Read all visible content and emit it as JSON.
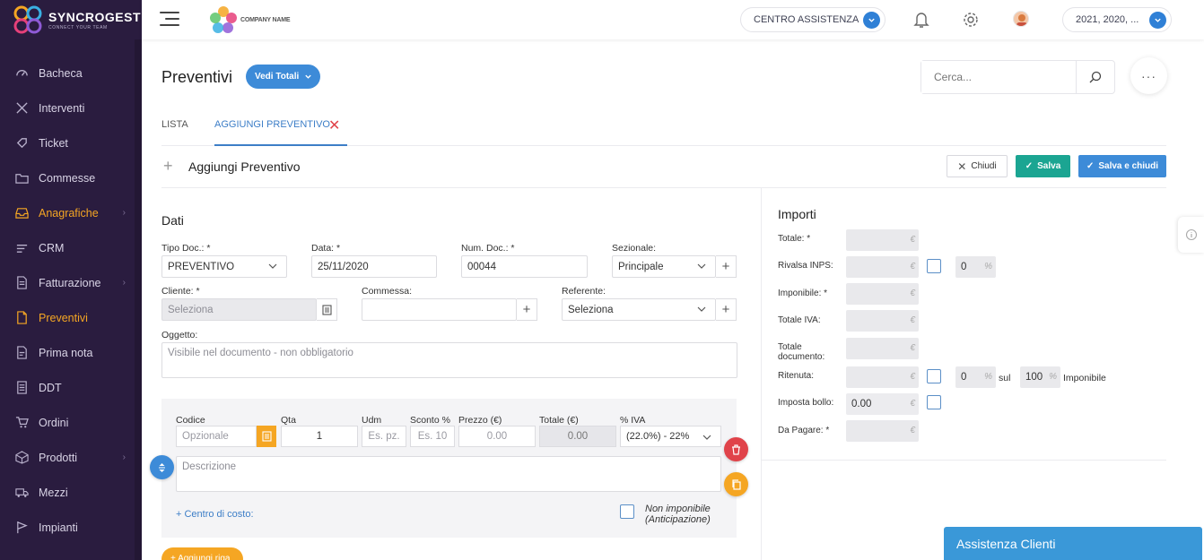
{
  "brand": {
    "name": "SYNCROGEST",
    "tagline": "CONNECT YOUR TEAM"
  },
  "sidebar": {
    "items": [
      {
        "label": "Bacheca",
        "icon": "gauge-icon",
        "active": false,
        "has_children": false
      },
      {
        "label": "Interventi",
        "icon": "tools-icon",
        "active": false,
        "has_children": false
      },
      {
        "label": "Ticket",
        "icon": "ticket-icon",
        "active": false,
        "has_children": false
      },
      {
        "label": "Commesse",
        "icon": "folder-icon",
        "active": false,
        "has_children": false
      },
      {
        "label": "Anagrafiche",
        "icon": "inbox-icon",
        "active": true,
        "has_children": true
      },
      {
        "label": "CRM",
        "icon": "crm-icon",
        "active": false,
        "has_children": false
      },
      {
        "label": "Fatturazione",
        "icon": "invoice-icon",
        "active": false,
        "has_children": true
      },
      {
        "label": "Preventivi",
        "icon": "quote-icon",
        "active": true,
        "has_children": false
      },
      {
        "label": "Prima nota",
        "icon": "note-icon",
        "active": false,
        "has_children": false
      },
      {
        "label": "DDT",
        "icon": "document-icon",
        "active": false,
        "has_children": false
      },
      {
        "label": "Ordini",
        "icon": "cart-icon",
        "active": false,
        "has_children": false
      },
      {
        "label": "Prodotti",
        "icon": "box-icon",
        "active": false,
        "has_children": true
      },
      {
        "label": "Mezzi",
        "icon": "truck-icon",
        "active": false,
        "has_children": false
      },
      {
        "label": "Impianti",
        "icon": "flag-icon",
        "active": false,
        "has_children": false
      }
    ],
    "active_color": "#f5a623"
  },
  "topbar": {
    "company_name": "COMPANY NAME",
    "help_label": "CENTRO ASSISTENZA",
    "years_label": "2021, 2020, ..."
  },
  "page": {
    "title": "Preventivi",
    "totals_button": "Vedi Totali",
    "search_placeholder": "Cerca...",
    "more": "···"
  },
  "tabs": [
    {
      "label": "LISTA",
      "active": false
    },
    {
      "label": "AGGIUNGI PREVENTIVO",
      "active": true
    }
  ],
  "form_header": {
    "title": "Aggiungi Preventivo",
    "close_label": "Chiudi",
    "save_label": "Salva",
    "save_close_label": "Salva e chiudi"
  },
  "dati": {
    "title": "Dati",
    "tipo_doc": {
      "label": "Tipo Doc.: *",
      "value": "PREVENTIVO"
    },
    "data": {
      "label": "Data: *",
      "value": "25/11/2020"
    },
    "num_doc": {
      "label": "Num. Doc.: *",
      "value": "00044"
    },
    "sezionale": {
      "label": "Sezionale:",
      "value": "Principale"
    },
    "cliente": {
      "label": "Cliente: *",
      "placeholder": "Seleziona"
    },
    "commessa": {
      "label": "Commessa:",
      "value": ""
    },
    "referente": {
      "label": "Referente:",
      "placeholder": "Seleziona"
    },
    "oggetto": {
      "label": "Oggetto:",
      "placeholder": "Visibile nel documento - non obbligatorio"
    }
  },
  "row": {
    "codice": {
      "label": "Codice",
      "placeholder": "Opzionale"
    },
    "qta": {
      "label": "Qta",
      "value": "1"
    },
    "udm": {
      "label": "Udm",
      "placeholder": "Es. pz."
    },
    "sconto": {
      "label": "Sconto %",
      "placeholder": "Es. 10"
    },
    "prezzo": {
      "label": "Prezzo (€)",
      "placeholder": "0.00"
    },
    "totale": {
      "label": "Totale (€)",
      "value": "0.00"
    },
    "iva": {
      "label": "% IVA",
      "value": "(22.0%) - 22%"
    },
    "descrizione_placeholder": "Descrizione",
    "centro_costo": "+ Centro di costo:",
    "non_imponibile_1": "Non imponibile",
    "non_imponibile_2": "(Anticipazione)",
    "add_button": "+ Aggiungi riga"
  },
  "importi": {
    "title": "Importi",
    "totale": "Totale: *",
    "rivalsa": "Rivalsa INPS:",
    "rivalsa_pct": "0",
    "imponibile": "Imponibile: *",
    "totale_iva": "Totale IVA:",
    "totale_doc_1": "Totale",
    "totale_doc_2": "documento:",
    "ritenuta": "Ritenuta:",
    "ritenuta_pct": "0",
    "sul": "sul",
    "ritenuta_base": "100",
    "imponibile_word": "Imponibile",
    "bollo": "Imposta bollo:",
    "bollo_value": "0.00",
    "da_pagare": "Da Pagare: *",
    "currency": "€",
    "percent": "%"
  },
  "assistenza": "Assistenza Clienti"
}
